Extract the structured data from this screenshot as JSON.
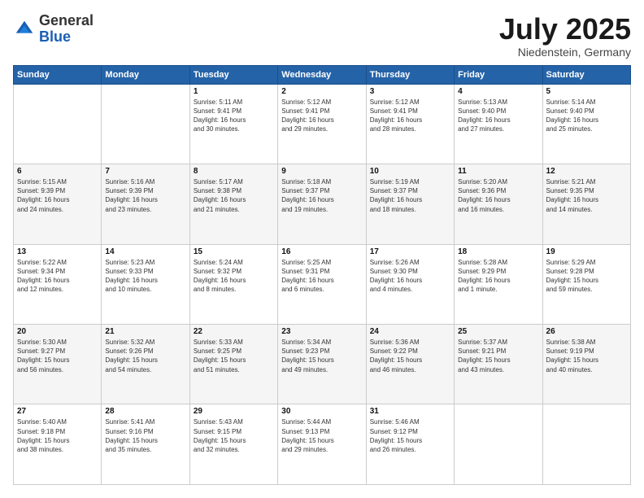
{
  "header": {
    "logo": {
      "general": "General",
      "blue": "Blue"
    },
    "title": "July 2025",
    "subtitle": "Niedenstein, Germany"
  },
  "calendar": {
    "days_of_week": [
      "Sunday",
      "Monday",
      "Tuesday",
      "Wednesday",
      "Thursday",
      "Friday",
      "Saturday"
    ],
    "weeks": [
      [
        {
          "day": "",
          "info": ""
        },
        {
          "day": "",
          "info": ""
        },
        {
          "day": "1",
          "info": "Sunrise: 5:11 AM\nSunset: 9:41 PM\nDaylight: 16 hours\nand 30 minutes."
        },
        {
          "day": "2",
          "info": "Sunrise: 5:12 AM\nSunset: 9:41 PM\nDaylight: 16 hours\nand 29 minutes."
        },
        {
          "day": "3",
          "info": "Sunrise: 5:12 AM\nSunset: 9:41 PM\nDaylight: 16 hours\nand 28 minutes."
        },
        {
          "day": "4",
          "info": "Sunrise: 5:13 AM\nSunset: 9:40 PM\nDaylight: 16 hours\nand 27 minutes."
        },
        {
          "day": "5",
          "info": "Sunrise: 5:14 AM\nSunset: 9:40 PM\nDaylight: 16 hours\nand 25 minutes."
        }
      ],
      [
        {
          "day": "6",
          "info": "Sunrise: 5:15 AM\nSunset: 9:39 PM\nDaylight: 16 hours\nand 24 minutes."
        },
        {
          "day": "7",
          "info": "Sunrise: 5:16 AM\nSunset: 9:39 PM\nDaylight: 16 hours\nand 23 minutes."
        },
        {
          "day": "8",
          "info": "Sunrise: 5:17 AM\nSunset: 9:38 PM\nDaylight: 16 hours\nand 21 minutes."
        },
        {
          "day": "9",
          "info": "Sunrise: 5:18 AM\nSunset: 9:37 PM\nDaylight: 16 hours\nand 19 minutes."
        },
        {
          "day": "10",
          "info": "Sunrise: 5:19 AM\nSunset: 9:37 PM\nDaylight: 16 hours\nand 18 minutes."
        },
        {
          "day": "11",
          "info": "Sunrise: 5:20 AM\nSunset: 9:36 PM\nDaylight: 16 hours\nand 16 minutes."
        },
        {
          "day": "12",
          "info": "Sunrise: 5:21 AM\nSunset: 9:35 PM\nDaylight: 16 hours\nand 14 minutes."
        }
      ],
      [
        {
          "day": "13",
          "info": "Sunrise: 5:22 AM\nSunset: 9:34 PM\nDaylight: 16 hours\nand 12 minutes."
        },
        {
          "day": "14",
          "info": "Sunrise: 5:23 AM\nSunset: 9:33 PM\nDaylight: 16 hours\nand 10 minutes."
        },
        {
          "day": "15",
          "info": "Sunrise: 5:24 AM\nSunset: 9:32 PM\nDaylight: 16 hours\nand 8 minutes."
        },
        {
          "day": "16",
          "info": "Sunrise: 5:25 AM\nSunset: 9:31 PM\nDaylight: 16 hours\nand 6 minutes."
        },
        {
          "day": "17",
          "info": "Sunrise: 5:26 AM\nSunset: 9:30 PM\nDaylight: 16 hours\nand 4 minutes."
        },
        {
          "day": "18",
          "info": "Sunrise: 5:28 AM\nSunset: 9:29 PM\nDaylight: 16 hours\nand 1 minute."
        },
        {
          "day": "19",
          "info": "Sunrise: 5:29 AM\nSunset: 9:28 PM\nDaylight: 15 hours\nand 59 minutes."
        }
      ],
      [
        {
          "day": "20",
          "info": "Sunrise: 5:30 AM\nSunset: 9:27 PM\nDaylight: 15 hours\nand 56 minutes."
        },
        {
          "day": "21",
          "info": "Sunrise: 5:32 AM\nSunset: 9:26 PM\nDaylight: 15 hours\nand 54 minutes."
        },
        {
          "day": "22",
          "info": "Sunrise: 5:33 AM\nSunset: 9:25 PM\nDaylight: 15 hours\nand 51 minutes."
        },
        {
          "day": "23",
          "info": "Sunrise: 5:34 AM\nSunset: 9:23 PM\nDaylight: 15 hours\nand 49 minutes."
        },
        {
          "day": "24",
          "info": "Sunrise: 5:36 AM\nSunset: 9:22 PM\nDaylight: 15 hours\nand 46 minutes."
        },
        {
          "day": "25",
          "info": "Sunrise: 5:37 AM\nSunset: 9:21 PM\nDaylight: 15 hours\nand 43 minutes."
        },
        {
          "day": "26",
          "info": "Sunrise: 5:38 AM\nSunset: 9:19 PM\nDaylight: 15 hours\nand 40 minutes."
        }
      ],
      [
        {
          "day": "27",
          "info": "Sunrise: 5:40 AM\nSunset: 9:18 PM\nDaylight: 15 hours\nand 38 minutes."
        },
        {
          "day": "28",
          "info": "Sunrise: 5:41 AM\nSunset: 9:16 PM\nDaylight: 15 hours\nand 35 minutes."
        },
        {
          "day": "29",
          "info": "Sunrise: 5:43 AM\nSunset: 9:15 PM\nDaylight: 15 hours\nand 32 minutes."
        },
        {
          "day": "30",
          "info": "Sunrise: 5:44 AM\nSunset: 9:13 PM\nDaylight: 15 hours\nand 29 minutes."
        },
        {
          "day": "31",
          "info": "Sunrise: 5:46 AM\nSunset: 9:12 PM\nDaylight: 15 hours\nand 26 minutes."
        },
        {
          "day": "",
          "info": ""
        },
        {
          "day": "",
          "info": ""
        }
      ]
    ]
  }
}
